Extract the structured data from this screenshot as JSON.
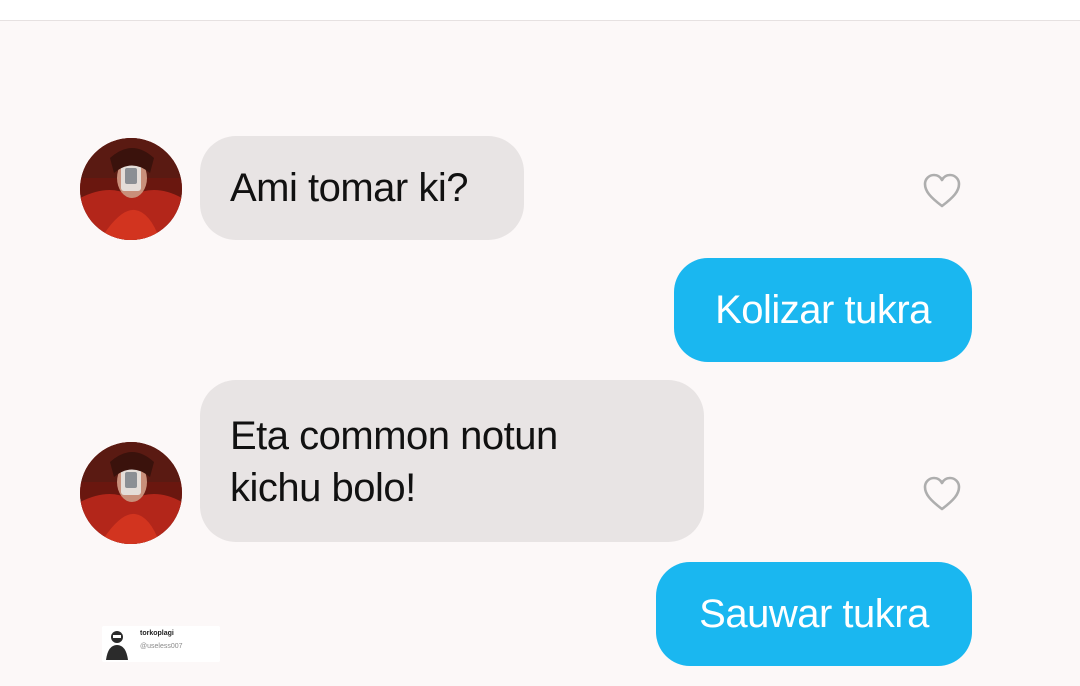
{
  "conversation": {
    "messages": [
      {
        "direction": "incoming",
        "text": "Ami tomar ki?"
      },
      {
        "direction": "outgoing",
        "text": "Kolizar tukra"
      },
      {
        "direction": "incoming",
        "text": "Eta common notun\nkichu bolo!"
      },
      {
        "direction": "outgoing",
        "text": "Sauwar tukra"
      }
    ],
    "heart_icon": "heart-outline-icon",
    "avatar_icon": "contact-avatar-photo"
  },
  "watermark": {
    "name": "torkoplagi",
    "handle": "@useless007"
  },
  "colors": {
    "background": "#fcf8f8",
    "incoming_bubble": "#e8e4e4",
    "outgoing_bubble": "#1ab7f0",
    "incoming_text": "#111111",
    "outgoing_text": "#ffffff",
    "heart_stroke": "#aeaeae"
  }
}
